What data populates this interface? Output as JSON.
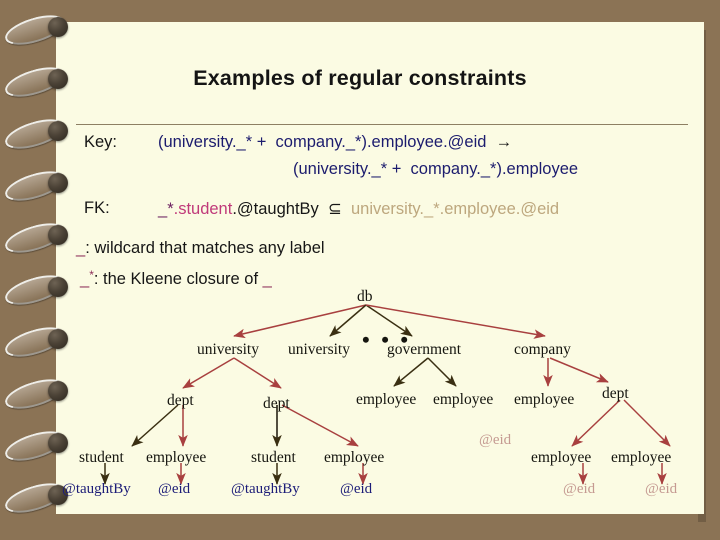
{
  "slide": {
    "title": "Examples of regular constraints",
    "background_color": "#8b7355",
    "paper_color": "#fbfbe3"
  },
  "constraints": {
    "key_label": "Key:",
    "key_line1_a": "(university._",
    "key_line1_star": "*",
    "key_line1_b": " +  company._",
    "key_line1_c": "*).employee.@eid  ",
    "key_line1_arrow": "→",
    "key_line2_a": "(university._",
    "key_line2_star": "*",
    "key_line2_b": " +  company._",
    "key_line2_c": "*).employee",
    "fk_label": "FK:",
    "fk_wild": "_",
    "fk_star": "*",
    "fk_student": ".student",
    "fk_taughtby": ".@taughtBy",
    "fk_subset": "  ⊆  ",
    "fk_right": "university._*.employee.@eid",
    "wildcard_note_sym": "_",
    "wildcard_note": ": wildcard that matches any label",
    "kleene_note_sym": "_",
    "kleene_note_star": "*",
    "kleene_note": ": the Kleene closure of ",
    "kleene_note_tail": "_"
  },
  "tree": {
    "root": "db",
    "ellipsis": "• • •",
    "level1": [
      {
        "label": "university"
      },
      {
        "label": "university"
      },
      {
        "label": "government"
      },
      {
        "label": "company"
      }
    ],
    "level2": [
      {
        "label": "dept"
      },
      {
        "label": "dept"
      },
      {
        "label": "employee"
      },
      {
        "label": "employee"
      },
      {
        "label": "employee"
      },
      {
        "label": "dept"
      }
    ],
    "level2_extra": [
      {
        "label": "@eid"
      }
    ],
    "level3": [
      {
        "label": "student"
      },
      {
        "label": "employee"
      },
      {
        "label": "student"
      },
      {
        "label": "employee"
      },
      {
        "label": "employee"
      },
      {
        "label": "employee"
      }
    ],
    "level4": [
      {
        "label": "@taughtBy"
      },
      {
        "label": "@eid"
      },
      {
        "label": "@taughtBy"
      },
      {
        "label": "@eid"
      },
      {
        "label": "@eid"
      },
      {
        "label": "@eid"
      }
    ],
    "colors": {
      "edge_red": "#a8403f",
      "edge_dark": "#3a2f12",
      "leaf_navy": "#1c1c78",
      "leaf_tan": "#c59a92"
    }
  }
}
